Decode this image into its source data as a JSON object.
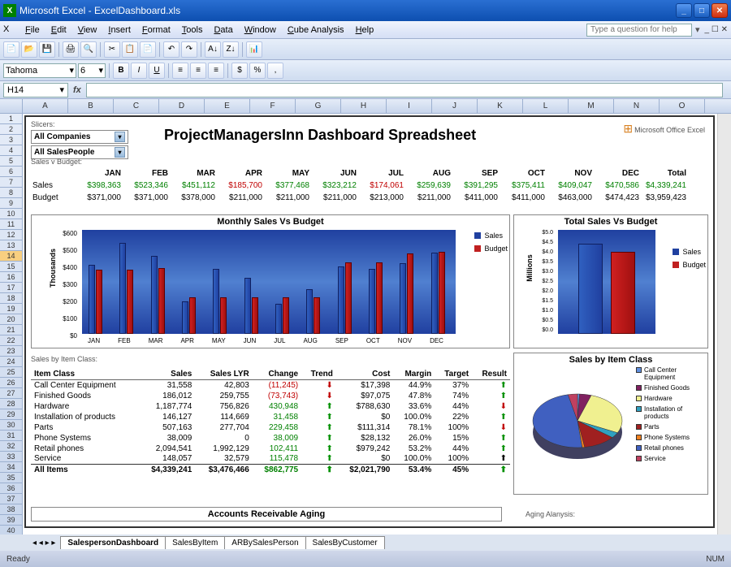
{
  "window": {
    "title": "Microsoft Excel - ExcelDashboard.xls"
  },
  "menu": [
    "File",
    "Edit",
    "View",
    "Insert",
    "Format",
    "Tools",
    "Data",
    "Window",
    "Cube Analysis",
    "Help"
  ],
  "help_placeholder": "Type a question for help",
  "font": {
    "name": "Tahoma",
    "size": "6"
  },
  "cell_ref": "H14",
  "columns": [
    "A",
    "B",
    "C",
    "D",
    "E",
    "F",
    "G",
    "H",
    "I",
    "J",
    "K",
    "L",
    "M",
    "N",
    "O"
  ],
  "slicers": {
    "label": "Slicers:",
    "company": "All Companies",
    "salespeople": "All SalesPeople"
  },
  "title": "ProjectManagersInn Dashboard Spreadsheet",
  "logo": "Microsoft Office Excel",
  "svb": {
    "label": "Sales v Budget:",
    "months": [
      "JAN",
      "FEB",
      "MAR",
      "APR",
      "MAY",
      "JUN",
      "JUL",
      "AUG",
      "SEP",
      "OCT",
      "NOV",
      "DEC",
      "Total"
    ],
    "sales_label": "Sales",
    "budget_label": "Budget",
    "sales": [
      "$398,363",
      "$523,346",
      "$451,112",
      "$185,700",
      "$377,468",
      "$323,212",
      "$174,061",
      "$259,639",
      "$391,295",
      "$375,411",
      "$409,047",
      "$470,586",
      "$4,339,241"
    ],
    "sales_neg": [
      false,
      false,
      false,
      true,
      false,
      false,
      true,
      false,
      false,
      false,
      false,
      false,
      false
    ],
    "budget": [
      "$371,000",
      "$371,000",
      "$378,000",
      "$211,000",
      "$211,000",
      "$211,000",
      "$213,000",
      "$211,000",
      "$411,000",
      "$411,000",
      "$463,000",
      "$474,423",
      "$3,959,423"
    ]
  },
  "chart1": {
    "title": "Monthly Sales Vs Budget",
    "ylabel": "Thousands",
    "yticks": [
      "$600",
      "$500",
      "$400",
      "$300",
      "$200",
      "$100",
      "$0"
    ],
    "series": [
      "Sales",
      "Budget"
    ],
    "cats": [
      "JAN",
      "FEB",
      "MAR",
      "APR",
      "MAY",
      "JUN",
      "JUL",
      "AUG",
      "SEP",
      "OCT",
      "NOV",
      "DEC"
    ]
  },
  "chart2": {
    "title": "Total Sales Vs Budget",
    "ylabel": "Millions",
    "yticks": [
      "$5.0",
      "$4.5",
      "$4.0",
      "$3.5",
      "$3.0",
      "$2.5",
      "$2.0",
      "$1.5",
      "$1.0",
      "$0.5",
      "$0.0"
    ],
    "series": [
      "Sales",
      "Budget"
    ]
  },
  "itemclass": {
    "label": "Sales by Item Class:",
    "headers": [
      "Item Class",
      "Sales",
      "Sales LYR",
      "Change",
      "Trend",
      "Cost",
      "Margin",
      "Target",
      "Result"
    ],
    "rows": [
      {
        "c": [
          "Call Center Equipment",
          "31,558",
          "42,803",
          "(11,245)",
          "d",
          "$17,398",
          "44.9%",
          "37%",
          "u"
        ]
      },
      {
        "c": [
          "Finished Goods",
          "186,012",
          "259,755",
          "(73,743)",
          "d",
          "$97,075",
          "47.8%",
          "74%",
          "u"
        ]
      },
      {
        "c": [
          "Hardware",
          "1,187,774",
          "756,826",
          "430,948",
          "u",
          "$788,630",
          "33.6%",
          "44%",
          "d"
        ]
      },
      {
        "c": [
          "Installation of products",
          "146,127",
          "114,669",
          "31,458",
          "u",
          "$0",
          "100.0%",
          "22%",
          "u"
        ]
      },
      {
        "c": [
          "Parts",
          "507,163",
          "277,704",
          "229,458",
          "u",
          "$111,314",
          "78.1%",
          "100%",
          "d"
        ]
      },
      {
        "c": [
          "Phone Systems",
          "38,009",
          "0",
          "38,009",
          "u",
          "$28,132",
          "26.0%",
          "15%",
          "u"
        ]
      },
      {
        "c": [
          "Retail phones",
          "2,094,541",
          "1,992,129",
          "102,411",
          "u",
          "$979,242",
          "53.2%",
          "44%",
          "u"
        ]
      },
      {
        "c": [
          "Service",
          "148,057",
          "32,579",
          "115,478",
          "u",
          "$0",
          "100.0%",
          "100%",
          "s"
        ]
      }
    ],
    "totals": [
      "All Items",
      "$4,339,241",
      "$3,476,466",
      "$862,775",
      "u",
      "$2,021,790",
      "53.4%",
      "45%",
      "u"
    ]
  },
  "pie": {
    "title": "Sales by Item Class",
    "items": [
      "Call Center Equipment",
      "Finished Goods",
      "Hardware",
      "Installation of products",
      "Parts",
      "Phone Systems",
      "Retail phones",
      "Service"
    ],
    "colors": [
      "#6090e0",
      "#802060",
      "#f0f090",
      "#30a0c0",
      "#a02020",
      "#f08020",
      "#4060c0",
      "#c04060"
    ]
  },
  "ar": {
    "label": "Accounts Receivable Aging",
    "aging_label": "Aging Alanysis:"
  },
  "tabs": [
    "SalespersonDashboard",
    "SalesByItem",
    "ARBySalesPerson",
    "SalesByCustomer"
  ],
  "status": {
    "ready": "Ready",
    "num": "NUM"
  },
  "chart_data": [
    {
      "type": "bar",
      "title": "Monthly Sales Vs Budget",
      "ylabel": "Thousands",
      "ylim": [
        0,
        600
      ],
      "categories": [
        "JAN",
        "FEB",
        "MAR",
        "APR",
        "MAY",
        "JUN",
        "JUL",
        "AUG",
        "SEP",
        "OCT",
        "NOV",
        "DEC"
      ],
      "series": [
        {
          "name": "Sales",
          "values": [
            398,
            523,
            451,
            186,
            377,
            323,
            174,
            260,
            391,
            375,
            409,
            471
          ]
        },
        {
          "name": "Budget",
          "values": [
            371,
            371,
            378,
            211,
            211,
            211,
            213,
            211,
            411,
            411,
            463,
            474
          ]
        }
      ]
    },
    {
      "type": "bar",
      "title": "Total Sales Vs Budget",
      "ylabel": "Millions",
      "ylim": [
        0,
        5
      ],
      "categories": [
        "Total"
      ],
      "series": [
        {
          "name": "Sales",
          "values": [
            4.34
          ]
        },
        {
          "name": "Budget",
          "values": [
            3.96
          ]
        }
      ]
    },
    {
      "type": "pie",
      "title": "Sales by Item Class",
      "categories": [
        "Call Center Equipment",
        "Finished Goods",
        "Hardware",
        "Installation of products",
        "Parts",
        "Phone Systems",
        "Retail phones",
        "Service"
      ],
      "values": [
        31558,
        186012,
        1187774,
        146127,
        507163,
        38009,
        2094541,
        148057
      ]
    }
  ]
}
